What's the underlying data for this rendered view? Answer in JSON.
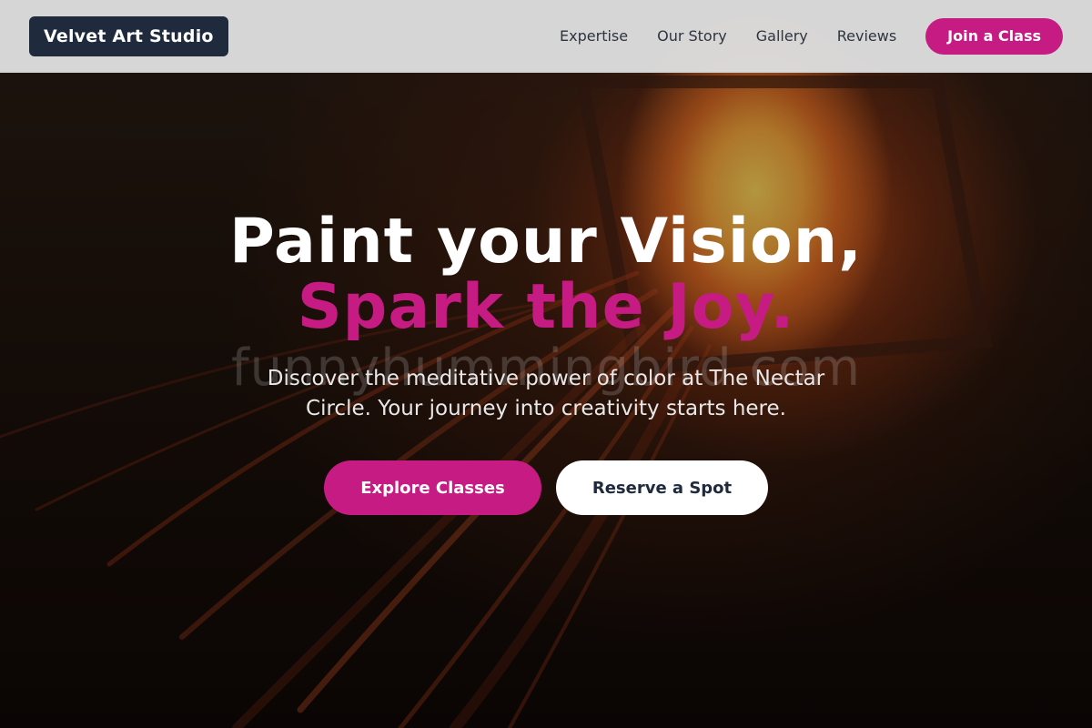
{
  "header": {
    "brand": "Velvet Art Studio",
    "nav": [
      {
        "label": "Expertise"
      },
      {
        "label": "Our Story"
      },
      {
        "label": "Gallery"
      },
      {
        "label": "Reviews"
      }
    ],
    "cta_label": "Join a Class"
  },
  "hero": {
    "title_line1": "Paint your Vision,",
    "title_line2": "Spark the Joy.",
    "watermark": "funnyhummingbird.com",
    "subtitle": "Discover the meditative power of color at The Nectar Circle. Your journey into creativity starts here.",
    "primary_cta": "Explore Classes",
    "secondary_cta": "Reserve a Spot"
  },
  "colors": {
    "accent": "#c71b84",
    "brand_bg": "#1f2a3d",
    "header_bg": "#dddddd"
  }
}
